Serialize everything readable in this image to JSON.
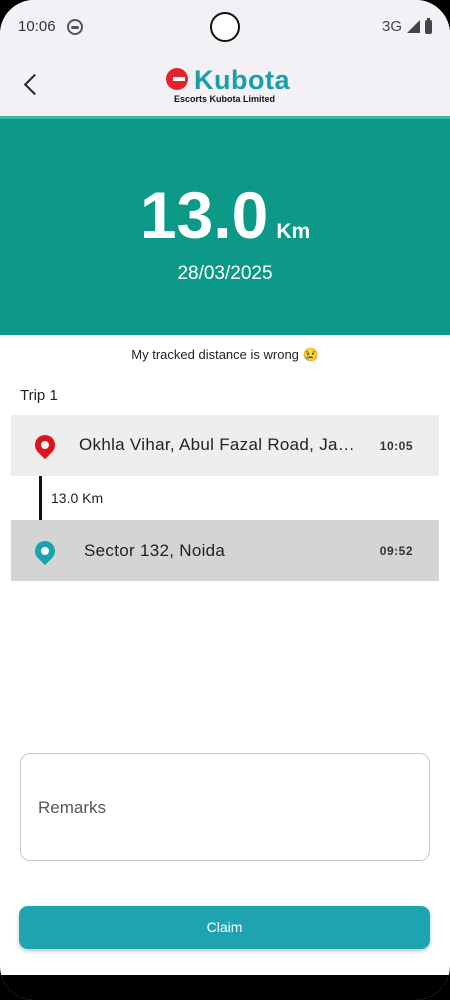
{
  "status_bar": {
    "time": "10:06",
    "network": "3G"
  },
  "header": {
    "logo_text": "Kubota",
    "logo_subtitle": "Escorts Kubota Limited",
    "back_icon": "chevron-left-icon"
  },
  "summary": {
    "distance_value": "13.0",
    "distance_unit": "Km",
    "date": "28/03/2025"
  },
  "report_link": "My tracked distance is wrong 😢",
  "trip": {
    "label": "Trip 1",
    "from": {
      "location": "Okhla Vihar, Abul Fazal Road, Jamia Nagar",
      "time": "10:05"
    },
    "leg_distance": "13.0 Km",
    "to": {
      "location": "Sector 132, Noida",
      "time": "09:52"
    }
  },
  "remarks": {
    "label": "Remarks"
  },
  "claim_button": {
    "label": "Claim"
  },
  "colors": {
    "hero": "#0c9987",
    "accent": "#1ea3b1",
    "pin_start": "#e0121f",
    "pin_end": "#1aa3b0"
  }
}
